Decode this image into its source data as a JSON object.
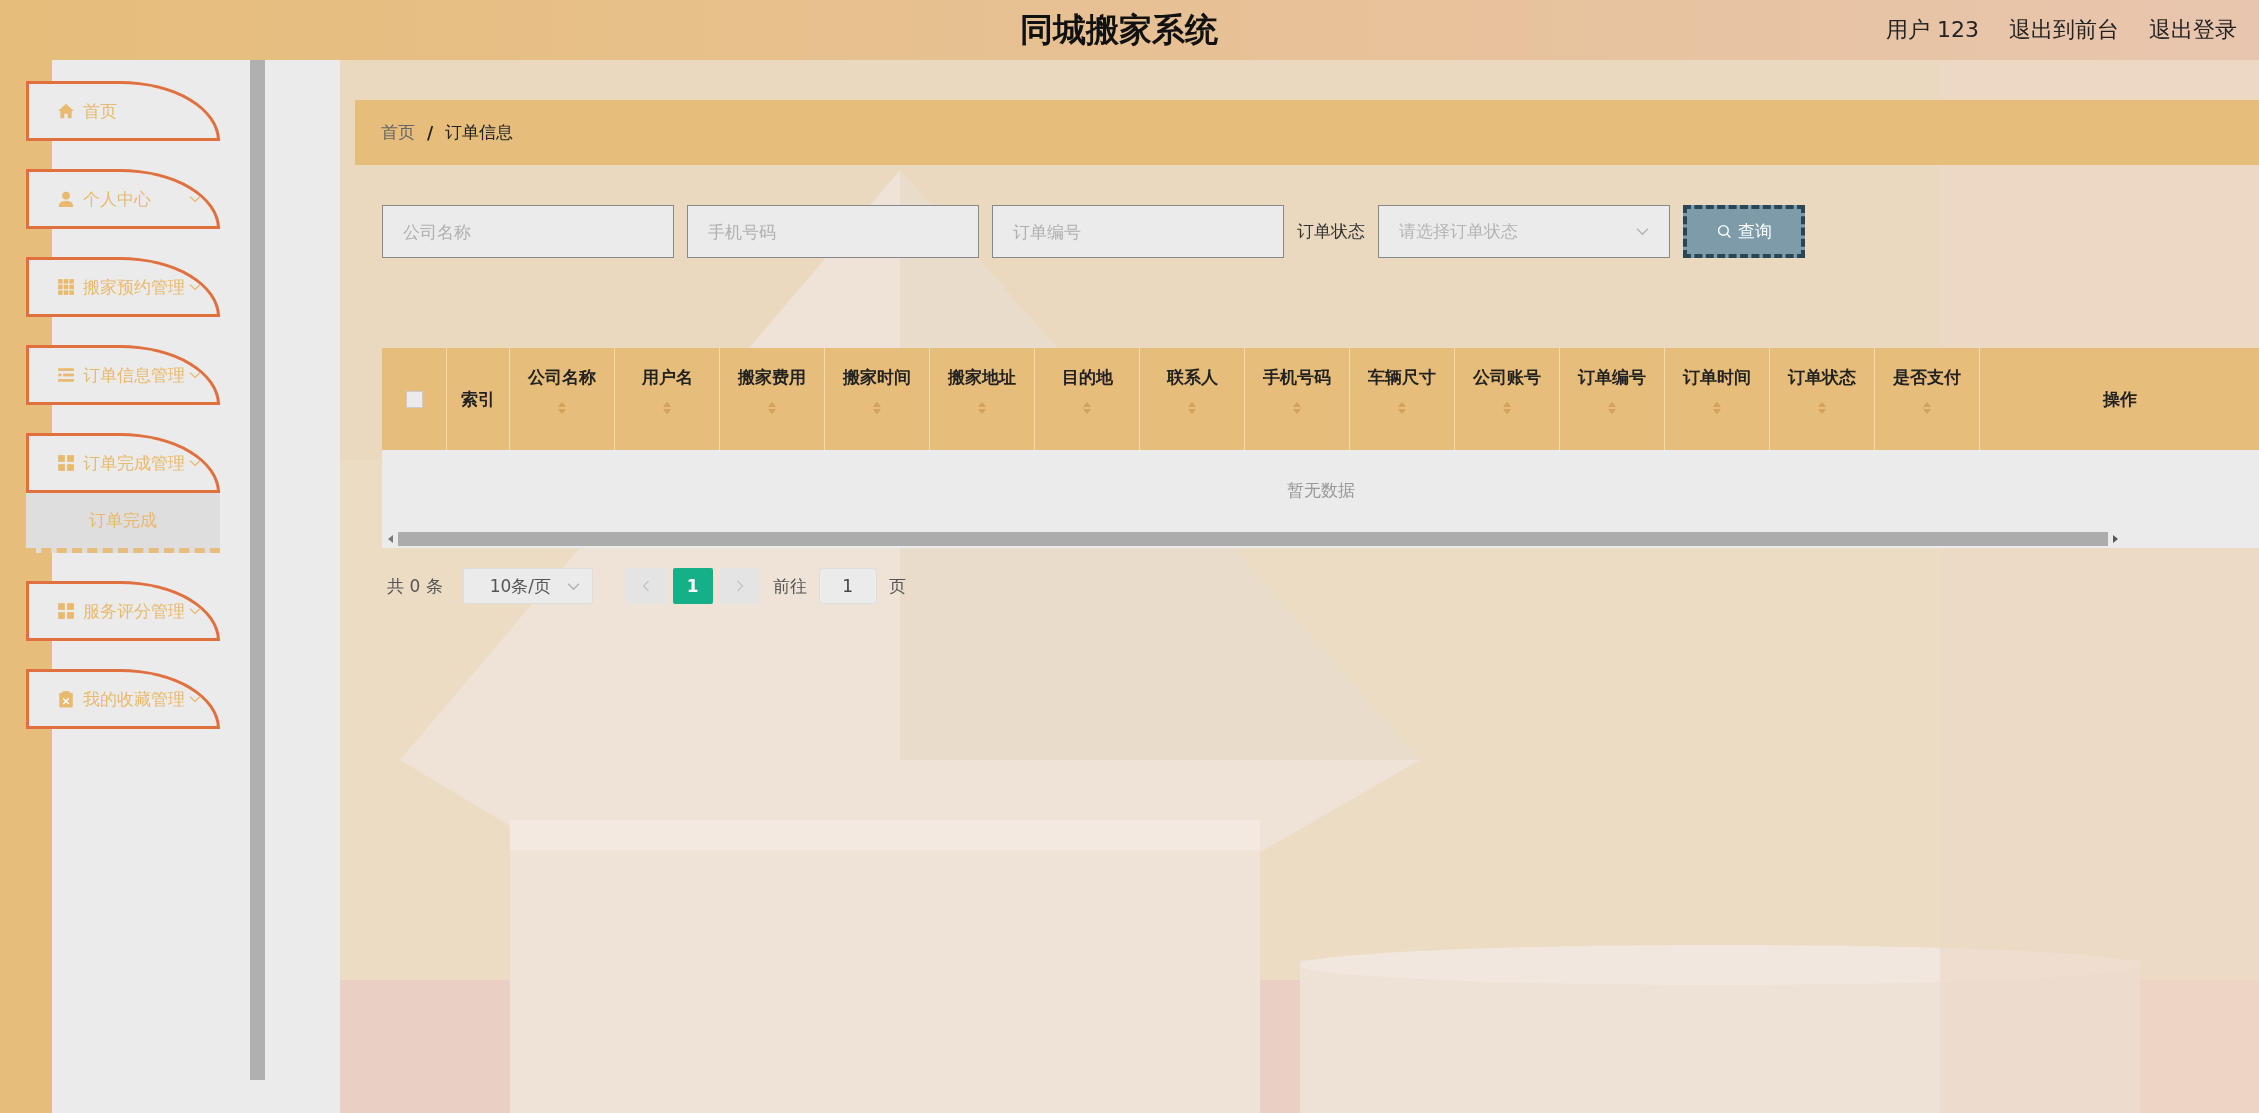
{
  "header": {
    "title": "同城搬家系统",
    "user": "用户 123",
    "links": [
      "退出到前台",
      "退出登录"
    ]
  },
  "sidebar": {
    "items": [
      {
        "label": "首页",
        "kind": "home"
      },
      {
        "label": "个人中心",
        "kind": "user"
      },
      {
        "label": "搬家预约管理",
        "kind": "grid9"
      },
      {
        "label": "订单信息管理",
        "kind": "list"
      },
      {
        "label": "订单完成管理",
        "kind": "grid4",
        "children": [
          {
            "label": "订单完成",
            "selected": true
          }
        ]
      },
      {
        "label": "服务评分管理",
        "kind": "grid4"
      },
      {
        "label": "我的收藏管理",
        "kind": "clipboard"
      }
    ]
  },
  "breadcrumb": {
    "items": [
      "首页",
      "订单信息"
    ],
    "separator": "/"
  },
  "search": {
    "fields": [
      {
        "placeholder": "公司名称"
      },
      {
        "placeholder": "手机号码"
      },
      {
        "placeholder": "订单编号"
      }
    ],
    "status_label": "订单状态",
    "status_select": {
      "placeholder": "请选择订单状态"
    },
    "button": "查询"
  },
  "table": {
    "checkbox": {
      "checked": false
    },
    "columns": [
      {
        "label": "索引",
        "sortable": false
      },
      {
        "label": "公司名称",
        "sortable": true
      },
      {
        "label": "用户名",
        "sortable": true
      },
      {
        "label": "搬家费用",
        "sortable": true
      },
      {
        "label": "搬家时间",
        "sortable": true
      },
      {
        "label": "搬家地址",
        "sortable": true
      },
      {
        "label": "目的地",
        "sortable": true
      },
      {
        "label": "联系人",
        "sortable": true
      },
      {
        "label": "手机号码",
        "sortable": true
      },
      {
        "label": "车辆尺寸",
        "sortable": true
      },
      {
        "label": "公司账号",
        "sortable": true
      },
      {
        "label": "订单编号",
        "sortable": true
      },
      {
        "label": "订单时间",
        "sortable": true
      },
      {
        "label": "订单状态",
        "sortable": true
      },
      {
        "label": "是否支付",
        "sortable": true
      },
      {
        "label": "操作",
        "sortable": false
      }
    ],
    "empty_text": "暂无数据"
  },
  "pagination": {
    "total": "共 0 条",
    "page_size": "10条/页",
    "prev": {
      "disabled": true
    },
    "pages": [
      {
        "label": "1",
        "selected": true
      }
    ],
    "next": {
      "disabled": true
    },
    "goto_label": "前往",
    "goto_value": "1",
    "goto_suffix": "页"
  }
}
